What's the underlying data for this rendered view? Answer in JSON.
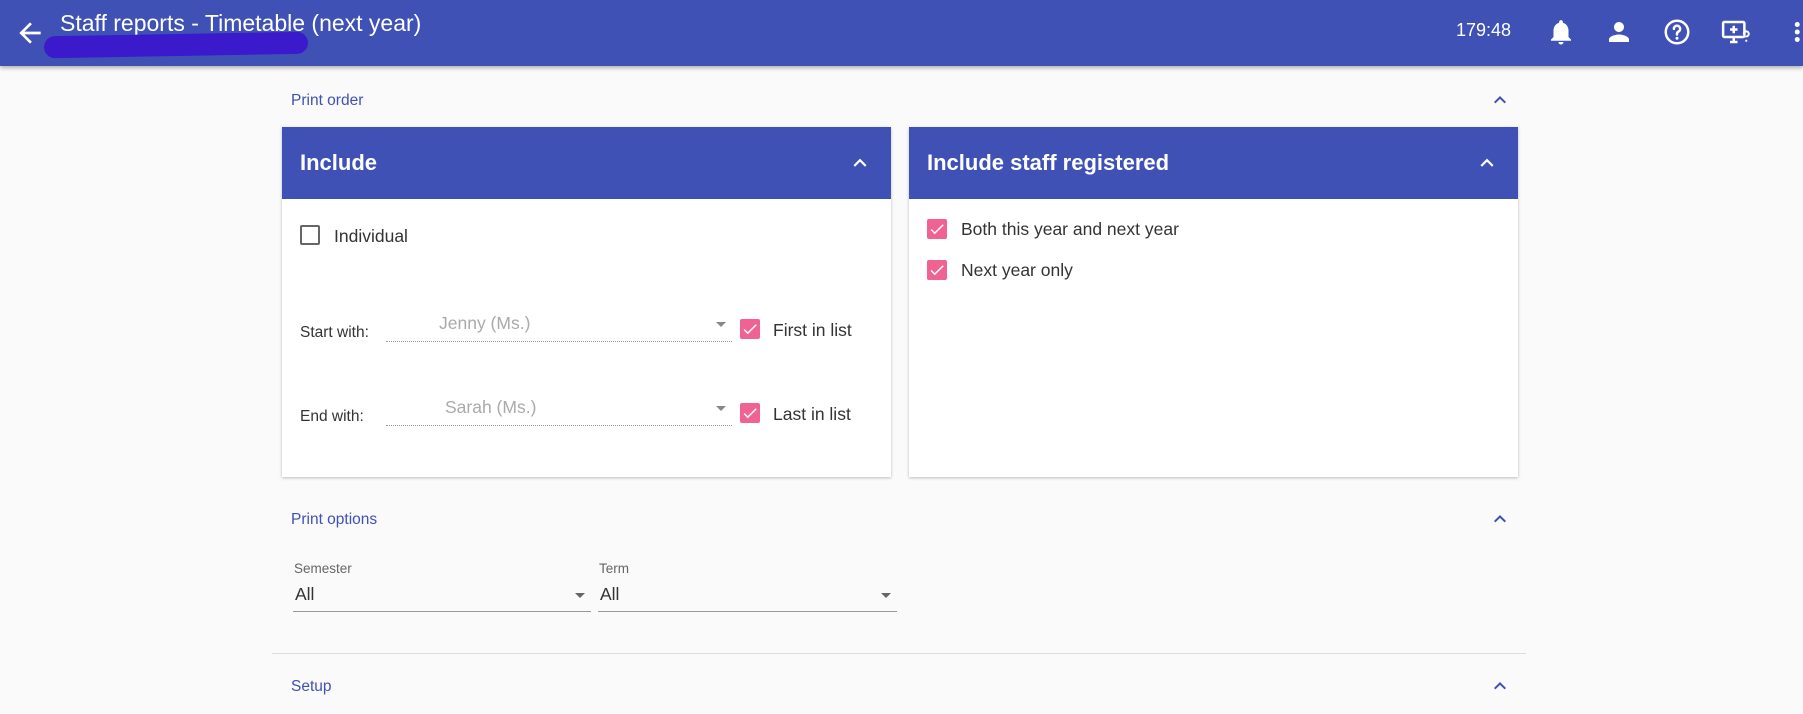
{
  "app_bar": {
    "title": "Staff reports - Timetable (next year)",
    "timer": "179:48",
    "icons": [
      "arrow-back-icon",
      "notifications-bell-icon",
      "account-icon",
      "help-icon",
      "screen-share-icon",
      "more-vert-icon"
    ]
  },
  "print_order": {
    "title": "Print order",
    "include_card": {
      "title": "Include",
      "individual": {
        "label": "Individual",
        "checked": false
      },
      "start_with": {
        "label": "Start with:",
        "value": "Jenny (Ms.)",
        "first_in_list_label": "First in list",
        "first_in_list_checked": true
      },
      "end_with": {
        "label": "End with:",
        "value": "Sarah (Ms.)",
        "last_in_list_label": "Last in list",
        "last_in_list_checked": true
      }
    },
    "staff_registered_card": {
      "title": "Include staff registered",
      "options": [
        {
          "label": "Both this year and next year",
          "checked": true
        },
        {
          "label": "Next year only",
          "checked": true
        }
      ]
    }
  },
  "print_options": {
    "title": "Print options",
    "semester": {
      "label": "Semester",
      "value": "All"
    },
    "term": {
      "label": "Term",
      "value": "All"
    }
  },
  "setup": {
    "title": "Setup"
  },
  "colors": {
    "primary": "#3f51b5",
    "checkbox_accent": "#f06292",
    "background": "#fafafa",
    "redaction": "#3a1acb"
  }
}
